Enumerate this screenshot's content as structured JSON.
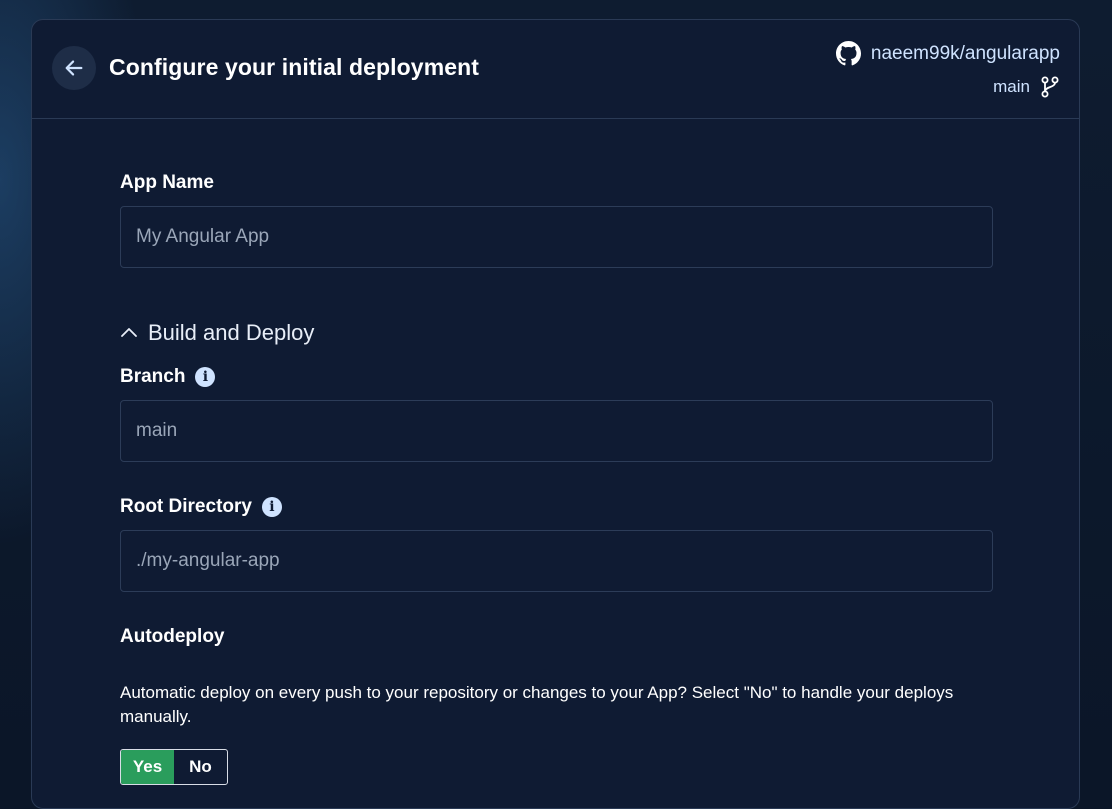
{
  "header": {
    "title": "Configure your initial deployment",
    "back_icon": "arrow-left-icon",
    "repo": "naeem99k/angularapp",
    "repo_icon": "github-icon",
    "branch": "main",
    "branch_icon": "git-branch-icon"
  },
  "form": {
    "app_name": {
      "label": "App Name",
      "placeholder": "My Angular App"
    },
    "build_section": {
      "label": "Build and Deploy",
      "icon": "chevron-up-icon"
    },
    "branch": {
      "label": "Branch",
      "placeholder": "main",
      "icon": "info-icon"
    },
    "root_directory": {
      "label": "Root Directory",
      "placeholder": "./my-angular-app",
      "icon": "info-icon"
    },
    "autodeploy": {
      "label": "Autodeploy",
      "description": "Automatic deploy on every push to your repository or changes to your App? Select \"No\" to handle your deploys manually.",
      "options": [
        "Yes",
        "No"
      ],
      "selected": "Yes"
    }
  },
  "colors": {
    "background": "#0b1628",
    "card": "#0f1b33",
    "border": "#2a3a55",
    "accent_green": "#2a9d5c",
    "link": "#cfe3ff"
  }
}
